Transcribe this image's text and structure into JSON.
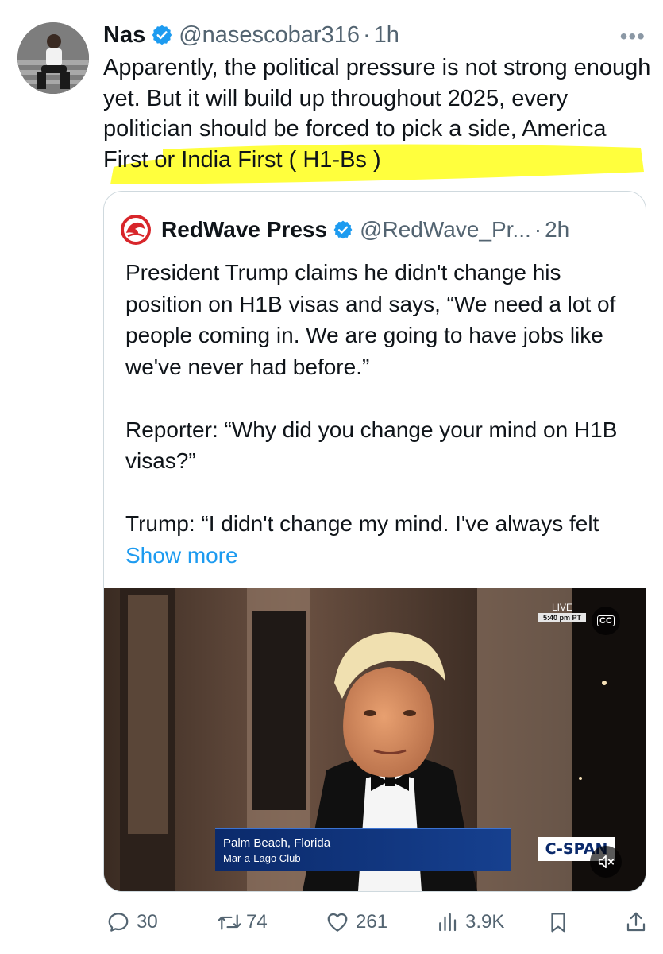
{
  "author": {
    "name": "Nas",
    "handle": "@nasescobar316",
    "time": "1h",
    "separator": "·"
  },
  "tweet": {
    "text": "Apparently, the political pressure is not strong enough yet. But it will build up throughout 2025, every politician should be forced to pick a side, America First or India First ( H1-Bs )"
  },
  "quote": {
    "name": "RedWave Press",
    "handle": "@RedWave_Pr...",
    "time": "2h",
    "separator": "·",
    "paragraph1": "President Trump claims he didn't change his position on H1B visas and says, “We need a lot of people coming in. We are going to have jobs like we've never had before.”",
    "paragraph2": "Reporter: “Why did you change your mind on H1B visas?”",
    "paragraph3_prefix": "Trump: “I didn't change my mind. I've always felt",
    "show_more": "Show more"
  },
  "video": {
    "live_label": "LIVE",
    "live_time": "5:40 pm PT",
    "cc_label": "CC",
    "lower_third_line1": "Palm Beach, Florida",
    "lower_third_line2": "Mar-a-Lago Club",
    "network_logo": "C-SPAN"
  },
  "actions": {
    "replies": "30",
    "reposts": "74",
    "likes": "261",
    "views": "3.9K"
  },
  "colors": {
    "verified": "#1d9bf0",
    "highlight": "#ffff33",
    "link": "#1d9bf0",
    "secondary_text": "#536471"
  }
}
